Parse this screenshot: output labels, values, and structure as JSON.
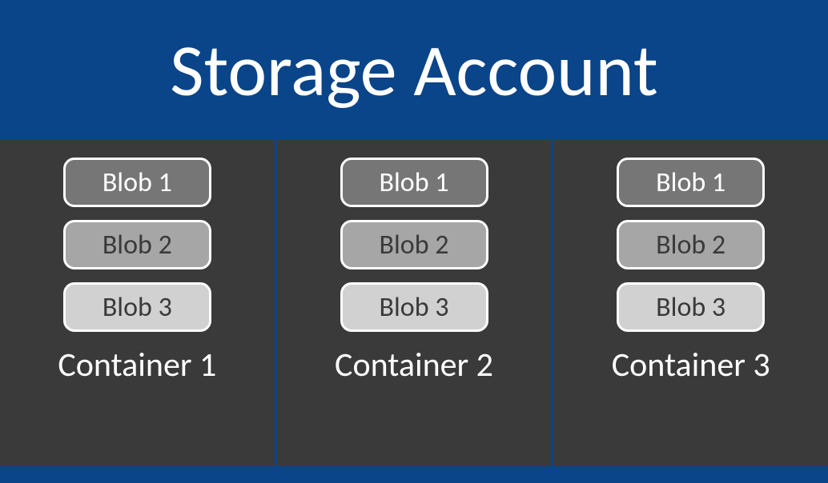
{
  "header": {
    "title": "Storage Account"
  },
  "containers": [
    {
      "label": "Container 1",
      "blobs": [
        "Blob 1",
        "Blob 2",
        "Blob 3"
      ]
    },
    {
      "label": "Container 2",
      "blobs": [
        "Blob 1",
        "Blob 2",
        "Blob 3"
      ]
    },
    {
      "label": "Container 3",
      "blobs": [
        "Blob 1",
        "Blob 2",
        "Blob 3"
      ]
    }
  ]
}
